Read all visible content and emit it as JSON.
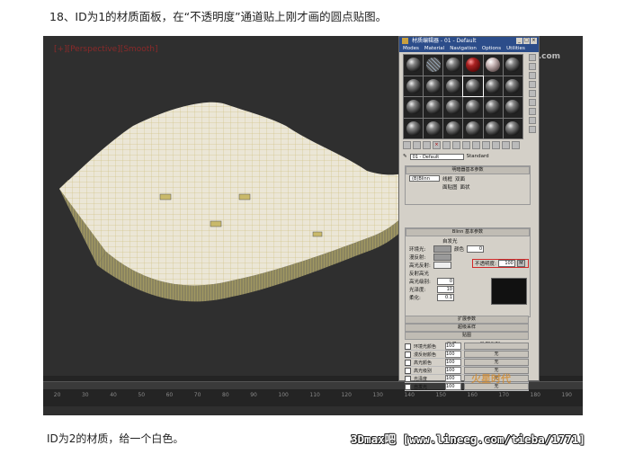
{
  "caption_top": "18、ID为1的材质面板，在“不透明度”通道贴上刚才画的圆点贴图。",
  "caption_bottom": "ID为2的材质，给一个白色。",
  "watermark_bottom": "3Dmax吧 [www.lineeg.com/tieba/1771]",
  "viewport": {
    "label": "[+][Perspective][Smooth]",
    "watermark": "思缘设计论坛 www.missyuan.com",
    "timeline_ticks": [
      "20",
      "30",
      "40",
      "50",
      "60",
      "70",
      "80",
      "90",
      "100",
      "110",
      "120",
      "130",
      "140",
      "150",
      "160",
      "170",
      "180",
      "190"
    ]
  },
  "material_editor": {
    "title": "材质编辑器 - 01 - Default",
    "menu": [
      "Modes",
      "Material",
      "Navigation",
      "Options",
      "Utilities"
    ],
    "material_name": "01 - Default",
    "material_type": "Standard",
    "shader_rollout": "明暗器基本参数",
    "shader_type": "(B)Blinn",
    "shader_options": [
      "线框",
      "双面",
      "面贴图",
      "面状"
    ],
    "blinn_rollout": "Blinn 基本参数",
    "self_illum_label": "自发光",
    "color_label": "颜色",
    "color_value": "0",
    "ambient_label": "环境光:",
    "diffuse_label": "漫反射:",
    "specular_label": "高光反射:",
    "opacity_label": "不透明度:",
    "opacity_value": "100",
    "opacity_map_button": "M",
    "spec_highlights_label": "反射高光",
    "spec_level_label": "高光级别:",
    "spec_level_value": "0",
    "glossiness_label": "光泽度:",
    "glossiness_value": "10",
    "soften_label": "柔化:",
    "soften_value": "0.1",
    "extended_rollout": "扩展参数",
    "supersampling_rollout": "超级采样",
    "maps_rollout": "贴图",
    "maps_header_amount": "数量",
    "maps_header_type": "贴图类型",
    "maps": [
      {
        "label": "环境光颜色",
        "amount": "100",
        "map": ""
      },
      {
        "label": "漫反射颜色",
        "amount": "100",
        "map": "无"
      },
      {
        "label": "高光颜色",
        "amount": "100",
        "map": "无"
      },
      {
        "label": "高光级别",
        "amount": "100",
        "map": "无"
      },
      {
        "label": "光泽度",
        "amount": "100",
        "map": "无"
      },
      {
        "label": "自发光",
        "amount": "100",
        "map": "无"
      }
    ]
  },
  "corner_logo": "火星时代",
  "colors": {
    "highlight_red": "#d12a2a",
    "title_blue": "#2c4d8a",
    "viewport_bg": "#2f2f2f"
  }
}
